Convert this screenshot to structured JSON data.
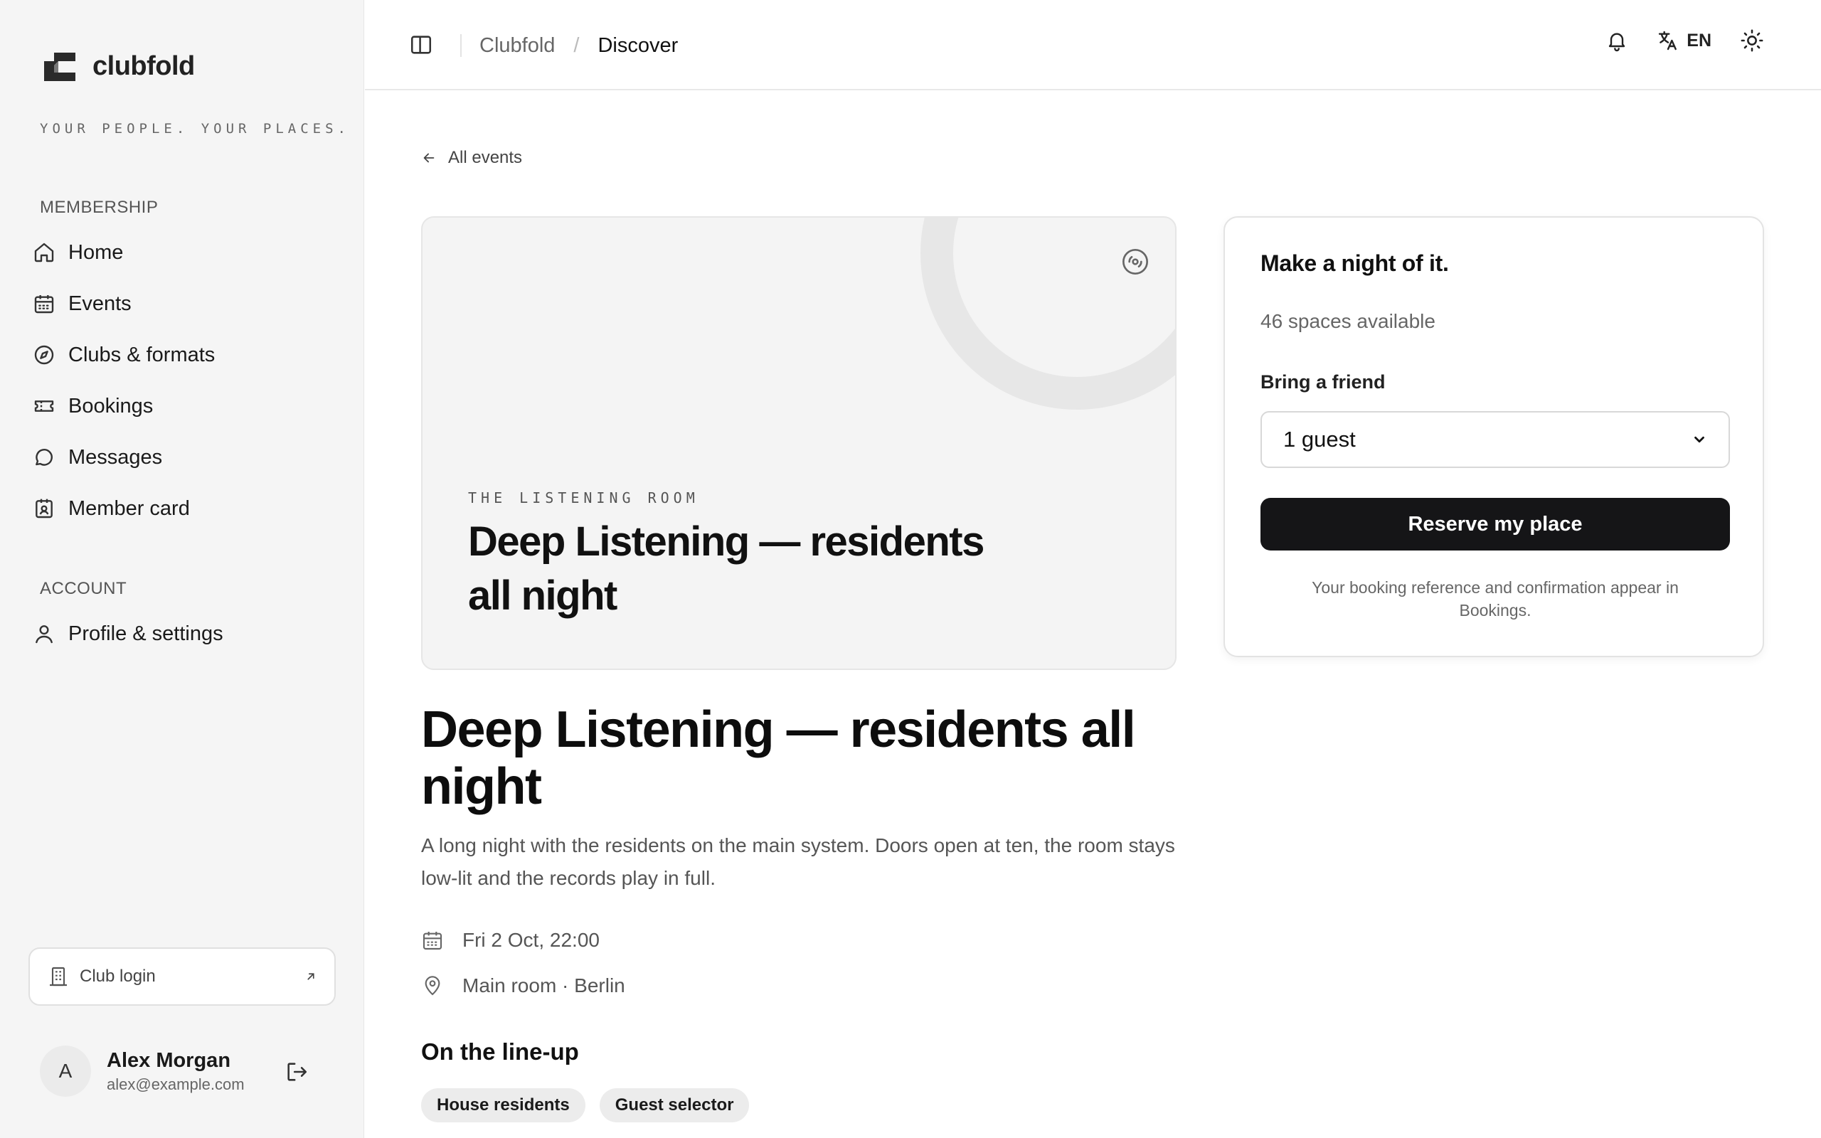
{
  "brand": {
    "name": "clubfold",
    "tagline": "YOUR PEOPLE. YOUR PLACES."
  },
  "sidebar": {
    "sections": [
      {
        "label": "MEMBERSHIP"
      },
      {
        "label": "ACCOUNT"
      }
    ],
    "items": [
      {
        "label": "Home",
        "icon": "home-icon"
      },
      {
        "label": "Events",
        "icon": "calendar-icon"
      },
      {
        "label": "Clubs & formats",
        "icon": "compass-icon"
      },
      {
        "label": "Bookings",
        "icon": "ticket-icon"
      },
      {
        "label": "Messages",
        "icon": "message-icon"
      },
      {
        "label": "Member card",
        "icon": "id-card-icon"
      },
      {
        "label": "Profile & settings",
        "icon": "user-icon"
      }
    ],
    "club_login": "Club login",
    "user": {
      "initial": "A",
      "name": "Alex Morgan",
      "email": "alex@example.com"
    }
  },
  "topbar": {
    "breadcrumb": [
      "Clubfold",
      "/",
      "Discover"
    ],
    "language": "EN"
  },
  "event": {
    "back_label": "All events",
    "kicker": "THE LISTENING ROOM",
    "hero_title": "Deep Listening — residents all night",
    "title": "Deep Listening — residents all night",
    "description": "A long night with the residents on the main system. Doors open at ten, the room stays low-lit and the records play in full.",
    "datetime": "Fri 2 Oct, 22:00",
    "location": "Main room · Berlin",
    "lineup_title": "On the line-up",
    "lineup": [
      "House residents",
      "Guest selector"
    ]
  },
  "booking": {
    "title": "Make a night of it.",
    "spaces": "46 spaces available",
    "friend_label": "Bring a friend",
    "guest_value": "1 guest",
    "button": "Reserve my place",
    "note": "Your booking reference and confirmation appear in Bookings."
  },
  "colors": {
    "accent": "#151517",
    "sidebar_bg": "#f5f5f5",
    "hero_bg": "#f4f4f4"
  }
}
